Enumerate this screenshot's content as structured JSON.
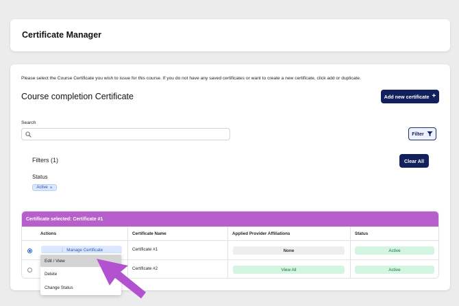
{
  "header": {
    "title": "Certificate Manager"
  },
  "main": {
    "intro": "Please select the Course Certificate you wish to issue for this course. If you do not have any saved certificates or want to create a new certificate, click add or duplicate.",
    "section_title": "Course completion Certificate",
    "add_button": "Add new certificate",
    "add_icon": "+"
  },
  "search": {
    "label": "Search",
    "placeholder": "",
    "value": ""
  },
  "filter_button": "Filter",
  "filters": {
    "title": "Filters (1)",
    "clear_all": "Clear All",
    "status_label": "Status",
    "chips": [
      {
        "label": "Active",
        "close": "×"
      }
    ]
  },
  "table": {
    "banner": "Certificate selected: Certificate #1",
    "columns": [
      "Actions",
      "Certificate Name",
      "Applied Provider Affiliations",
      "Status"
    ],
    "rows": [
      {
        "selected": true,
        "action": "Manage Certificate",
        "name": "Certificate #1",
        "affiliations": "None",
        "status": "Active"
      },
      {
        "selected": false,
        "action": "",
        "name": "Certificate #2",
        "affiliations": "View All",
        "status": "Active"
      }
    ],
    "action_icon": "⋮"
  },
  "menu": {
    "items": [
      "Edit / View",
      "Delete",
      "Change Status"
    ],
    "active_index": 0
  },
  "colors": {
    "primary": "#13205e",
    "banner": "#b75fcb",
    "arrow": "#b252cf",
    "status_green": "#d3f5e1"
  }
}
